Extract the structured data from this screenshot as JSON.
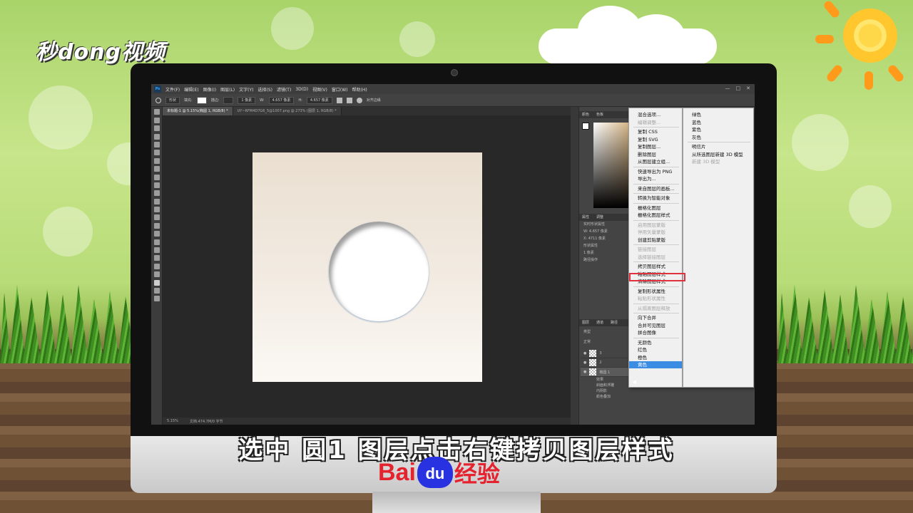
{
  "brand": {
    "channel_logo": "秒dong视频",
    "baidu_bai": "Bai",
    "baidu_du": "du",
    "baidu_jingyan": "经验"
  },
  "subtitle": "选中  圆1  图层点击右键拷贝图层样式",
  "app": {
    "icon_label": "Ps",
    "menu": [
      "文件(F)",
      "编辑(E)",
      "图像(I)",
      "图层(L)",
      "文字(Y)",
      "选择(S)",
      "滤镜(T)",
      "3D(D)",
      "视图(V)",
      "窗口(W)",
      "帮助(H)"
    ],
    "window_controls": [
      "—",
      "□",
      "✕"
    ]
  },
  "options_bar": {
    "mode": "形状",
    "fill_label": "填充:",
    "stroke_label": "描边:",
    "stroke_width": "1 像素",
    "width_label": "W:",
    "width_value": "4.657 像素",
    "height_label": "H:",
    "height_value": "4.657 像素",
    "align_edges": "对齐边缘"
  },
  "tabs": [
    {
      "label": "未标题-1 @ 5.15%(椭圆 1, RGB/8) *",
      "active": true
    },
    {
      "label": "UY~RFM4D7G6_5@1007.png @ 273% (图层 1, RGB/8) *",
      "active": false
    }
  ],
  "statusbar": {
    "zoom": "5.15%",
    "doc": "文档:474.7M/0 字节"
  },
  "panels": {
    "color_tabs": [
      "颜色",
      "色板"
    ],
    "props_tabs": [
      "属性",
      "调整"
    ],
    "props_rows": [
      "实时形状属性",
      "W: 4.657 像素",
      "X: 4711 像素",
      "形状属性",
      "1 像素",
      "路径操作"
    ],
    "layers_tabs": [
      "图层",
      "通道",
      "路径"
    ],
    "layers_filter": "类型",
    "layers_mode": "正常",
    "layers": [
      {
        "name": "3",
        "selected": false
      },
      {
        "name": "2",
        "selected": false
      },
      {
        "name": "椭圆 1",
        "selected": true
      }
    ],
    "effects": [
      "效果",
      "斜面和浮雕",
      "内阴影",
      "颜色叠加"
    ]
  },
  "context_menu": {
    "items": [
      {
        "label": "混合选项...",
        "disabled": false
      },
      {
        "label": "编辑调整...",
        "disabled": true
      },
      {
        "sep": true
      },
      {
        "label": "复制 CSS",
        "disabled": false
      },
      {
        "label": "复制 SVG",
        "disabled": false
      },
      {
        "label": "复制图层...",
        "disabled": false
      },
      {
        "label": "删除图层",
        "disabled": false
      },
      {
        "label": "从图层建立组...",
        "disabled": false
      },
      {
        "sep": true
      },
      {
        "label": "快速导出为 PNG",
        "disabled": false
      },
      {
        "label": "导出为...",
        "disabled": false
      },
      {
        "sep": true
      },
      {
        "label": "来自图层的画板...",
        "disabled": false
      },
      {
        "sep": true
      },
      {
        "label": "转换为智能对象",
        "disabled": false
      },
      {
        "sep": true
      },
      {
        "label": "栅格化图层",
        "disabled": false
      },
      {
        "label": "栅格化图层样式",
        "disabled": false
      },
      {
        "sep": true
      },
      {
        "label": "启用图层蒙版",
        "disabled": true
      },
      {
        "label": "停用矢量蒙版",
        "disabled": true
      },
      {
        "label": "创建剪贴蒙版",
        "disabled": false
      },
      {
        "sep": true
      },
      {
        "label": "链接图层",
        "disabled": true
      },
      {
        "label": "选择链接图层",
        "disabled": true
      },
      {
        "sep": true
      },
      {
        "label": "拷贝图层样式",
        "disabled": false
      },
      {
        "label": "粘贴图层样式",
        "disabled": false
      },
      {
        "label": "清除图层样式",
        "disabled": false
      },
      {
        "sep": true
      },
      {
        "label": "复制形状属性",
        "disabled": false
      },
      {
        "label": "粘贴形状属性",
        "disabled": true
      },
      {
        "sep": true
      },
      {
        "label": "从隔离图层释放",
        "disabled": true
      },
      {
        "sep": true
      },
      {
        "label": "向下合并",
        "disabled": false
      },
      {
        "label": "合并可见图层",
        "disabled": false
      },
      {
        "label": "拼合图像",
        "disabled": false
      },
      {
        "sep": true
      },
      {
        "label": "无颜色",
        "disabled": false
      },
      {
        "label": "红色",
        "disabled": false
      },
      {
        "label": "橙色",
        "disabled": false
      },
      {
        "label": "黄色",
        "disabled": false,
        "active": true
      }
    ],
    "submenu": [
      {
        "label": "绿色",
        "disabled": false
      },
      {
        "label": "蓝色",
        "disabled": false
      },
      {
        "label": "紫色",
        "disabled": false
      },
      {
        "label": "灰色",
        "disabled": false
      },
      {
        "sep": true
      },
      {
        "label": "明信片",
        "disabled": false
      },
      {
        "label": "从所选图层新建 3D 模型",
        "disabled": false
      },
      {
        "label": "新建 3D 模型",
        "disabled": true
      }
    ]
  },
  "colors": {
    "highlight": "#e0313e",
    "selection": "#3b8de4"
  }
}
